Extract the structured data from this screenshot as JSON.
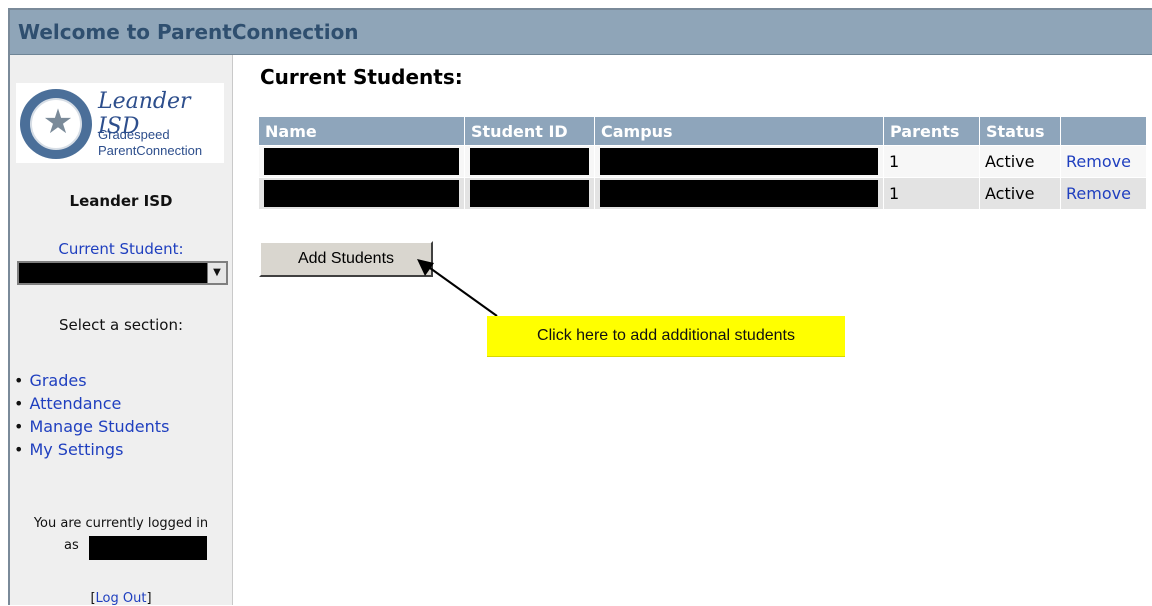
{
  "header": {
    "title": "Welcome to ParentConnection"
  },
  "sidebar": {
    "logo": {
      "title": "Leander ISD",
      "line1": "Gradespeed",
      "line2": "ParentConnection"
    },
    "district": "Leander ISD",
    "current_student_label": "Current Student:",
    "select_section_label": "Select a section:",
    "nav": [
      {
        "label": "Grades"
      },
      {
        "label": "Attendance"
      },
      {
        "label": "Manage Students"
      },
      {
        "label": "My Settings"
      }
    ],
    "logged_in_text": "You are currently logged in",
    "as_text": "as",
    "logout": {
      "open": "[",
      "label": "Log Out",
      "close": "]"
    }
  },
  "main": {
    "title": "Current Students:",
    "table": {
      "headers": [
        "Name",
        "Student ID",
        "Campus",
        "Parents",
        "Status",
        ""
      ],
      "rows": [
        {
          "parents": "1",
          "status": "Active",
          "action": "Remove"
        },
        {
          "parents": "1",
          "status": "Active",
          "action": "Remove"
        }
      ]
    },
    "add_button": "Add Students",
    "callout": "Click here to add additional students"
  },
  "colors": {
    "header_bg": "#8fa5b8",
    "header_text": "#2f4f6f",
    "table_header_bg": "#8ea5bb",
    "link": "#1f3fbf",
    "callout_bg": "#ffff00"
  },
  "icons": {
    "seal": "district-seal-icon",
    "dropdown": "dropdown-arrow-icon",
    "arrow": "pointer-arrow-icon"
  }
}
